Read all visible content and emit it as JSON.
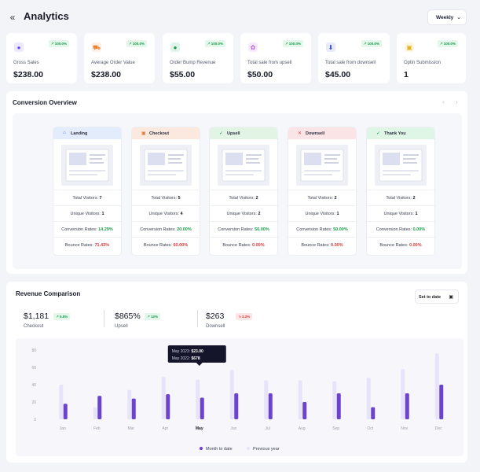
{
  "header": {
    "title": "Analytics",
    "period": "Weekly"
  },
  "stats": [
    {
      "label": "Gross Sales",
      "value": "$238.00",
      "change": "↗ 100.0%",
      "icon": "money-bag-icon",
      "color": "#6a4de0"
    },
    {
      "label": "Average Order Value",
      "value": "$238.00",
      "change": "↗ 100.0%",
      "icon": "cart-icon",
      "color": "#f07d2a"
    },
    {
      "label": "Order Bump Revenue",
      "value": "$55.00",
      "change": "↗ 100.0%",
      "icon": "bag-icon",
      "color": "#1b9a4c"
    },
    {
      "label": "Total sale from upsell",
      "value": "$50.00",
      "change": "↗ 100.0%",
      "icon": "upsell-icon",
      "color": "#b45ad8"
    },
    {
      "label": "Total sale from downsell",
      "value": "$45.00",
      "change": "↗ 100.0%",
      "icon": "downsell-icon",
      "color": "#3a4fc8"
    },
    {
      "label": "Optin Submission",
      "value": "1",
      "change": "↗ 100.0%",
      "icon": "optin-icon",
      "color": "#e6b21a"
    }
  ],
  "conversion": {
    "title": "Conversion Overview",
    "labels": {
      "total": "Total Visitors: ",
      "unique": "Unique Visitors: ",
      "rate": "Conversion Rates: ",
      "bounce": "Bounce Rates: "
    },
    "steps": [
      {
        "name": "Landing",
        "icon": "home-icon",
        "head_bg": "#e3ecfa",
        "head_color": "#4a6fd1",
        "total": "7",
        "unique": "1",
        "rate": "14.29%",
        "bounce": "71.43%"
      },
      {
        "name": "Checkout",
        "icon": "bag-icon",
        "head_bg": "#fbe8de",
        "head_color": "#e0763a",
        "total": "5",
        "unique": "4",
        "rate": "20.00%",
        "bounce": "60.00%"
      },
      {
        "name": "Upsell",
        "icon": "check-circle-icon",
        "head_bg": "#e2f5e4",
        "head_color": "#1b9a4c",
        "total": "2",
        "unique": "2",
        "rate": "50.00%",
        "bounce": "0.00%"
      },
      {
        "name": "Downsell",
        "icon": "cross-circle-icon",
        "head_bg": "#fbe4e6",
        "head_color": "#d84a5a",
        "total": "2",
        "unique": "1",
        "rate": "50.00%",
        "bounce": "0.00%"
      },
      {
        "name": "Thank You",
        "icon": "check-circle-icon",
        "head_bg": "#dff5e6",
        "head_color": "#1b9a4c",
        "total": "2",
        "unique": "1",
        "rate": "0.00%",
        "bounce": "0.00%"
      }
    ]
  },
  "revenue": {
    "title": "Revenue Comparison",
    "set_date": "Set to date",
    "kpis": [
      {
        "value": "$1,181",
        "label": "Checkout",
        "change": "↗ 5.5%",
        "trend": "up"
      },
      {
        "value": "$865%",
        "label": "Upsell",
        "change": "↗ 12%",
        "trend": "up"
      },
      {
        "value": "$263",
        "label": "Downsell",
        "change": "↘ 3.2%",
        "trend": "down"
      }
    ],
    "tooltip": {
      "line1_label": "May 2023: ",
      "line1_value": "$23.00",
      "line2_label": "May 2022: ",
      "line2_value": "$678"
    }
  },
  "chart_data": {
    "type": "bar",
    "categories": [
      "Jan",
      "Feb",
      "Mar",
      "Apr",
      "May",
      "Jun",
      "Jul",
      "Aug",
      "Sep",
      "Oct",
      "Nov",
      "Dec"
    ],
    "yticks": [
      0,
      20,
      40,
      60,
      80
    ],
    "ylim": [
      0,
      80
    ],
    "highlighted_category": "May",
    "series": [
      {
        "name": "Month to date",
        "color": "#6c43cc",
        "values": [
          18,
          27,
          24,
          29,
          25,
          30,
          30,
          20,
          30,
          14,
          30,
          40
        ]
      },
      {
        "name": "Previous year",
        "color": "#e7e3fb",
        "values": [
          40,
          14,
          34,
          49,
          46,
          57,
          45,
          45,
          44,
          48,
          58,
          76
        ]
      }
    ],
    "legend": "bottom"
  }
}
